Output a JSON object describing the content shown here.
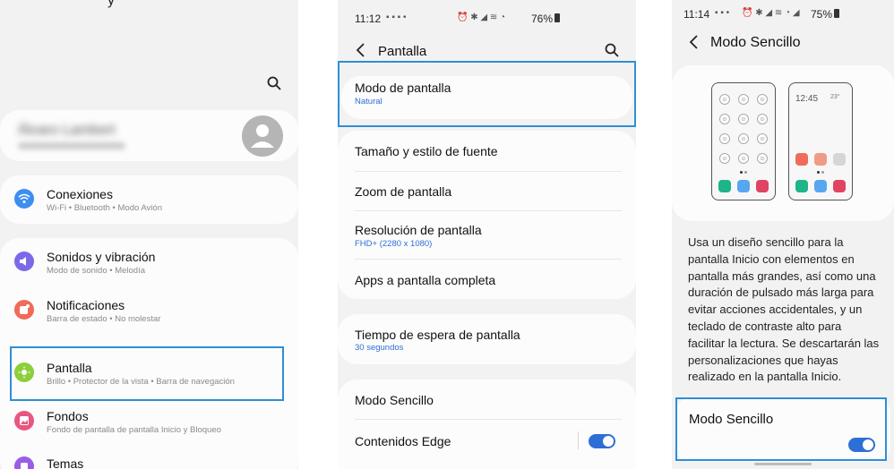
{
  "colors": {
    "accent": "#2e6fd6",
    "highlight": "#2e8fd6",
    "panel_bg": "#f2f2f2",
    "card_bg": "#fcfcfc"
  },
  "panel1": {
    "partial_top_text": "y",
    "search_icon": "search-icon",
    "account_name": "Álvaro Lambert",
    "avatar_icon": "person-icon",
    "items": [
      {
        "title": "Conexiones",
        "subtitle": "Wi-Fi  •  Bluetooth  •  Modo Avión",
        "icon": "wifi-icon",
        "color": "#3d8ef0"
      },
      {
        "title": "Sonidos y vibración",
        "subtitle": "Modo de sonido  •  Melodía",
        "icon": "volume-icon",
        "color": "#7b6ae8"
      },
      {
        "title": "Notificaciones",
        "subtitle": "Barra de estado  •  No molestar",
        "icon": "notification-icon",
        "color": "#ef6b5a"
      },
      {
        "title": "Pantalla",
        "subtitle": "Brillo  •  Protector de la vista  •  Barra de navegación",
        "icon": "brightness-icon",
        "color": "#8ccf3a"
      },
      {
        "title": "Fondos",
        "subtitle": "Fondo de pantalla de pantalla Inicio y Bloqueo",
        "icon": "wallpaper-icon",
        "color": "#e9567f"
      },
      {
        "title": "Temas",
        "subtitle": "",
        "icon": "themes-icon",
        "color": "#9b5de5"
      }
    ]
  },
  "panel2": {
    "status_time": "11:12",
    "status_battery": "76%",
    "header_title": "Pantalla",
    "items": [
      {
        "title": "Modo de pantalla",
        "subtitle": "Natural"
      },
      {
        "title": "Tamaño y estilo de fuente",
        "subtitle": ""
      },
      {
        "title": "Zoom de pantalla",
        "subtitle": ""
      },
      {
        "title": "Resolución de pantalla",
        "subtitle": "FHD+ (2280 x 1080)"
      },
      {
        "title": "Apps a pantalla completa",
        "subtitle": ""
      },
      {
        "title": "Tiempo de espera de pantalla",
        "subtitle": "30 segundos"
      },
      {
        "title": "Modo Sencillo",
        "subtitle": ""
      },
      {
        "title": "Contenidos Edge",
        "subtitle": ""
      }
    ],
    "edge_toggle_on": true
  },
  "panel3": {
    "status_time": "11:14",
    "status_battery": "75%",
    "header_title": "Modo Sencillo",
    "preview_time": "12:45",
    "preview_weather": "23°",
    "description": "Usa un diseño sencillo para la pantalla Inicio con elementos en pantalla más grandes, así como una duración de pulsado más larga para evitar acciones accidentales, y un teclado de contraste alto para facilitar la lectura. Se descartarán las personalizaciones que hayas realizado en la pantalla Inicio.",
    "toggle_label": "Modo Sencillo",
    "toggle_on": true
  }
}
